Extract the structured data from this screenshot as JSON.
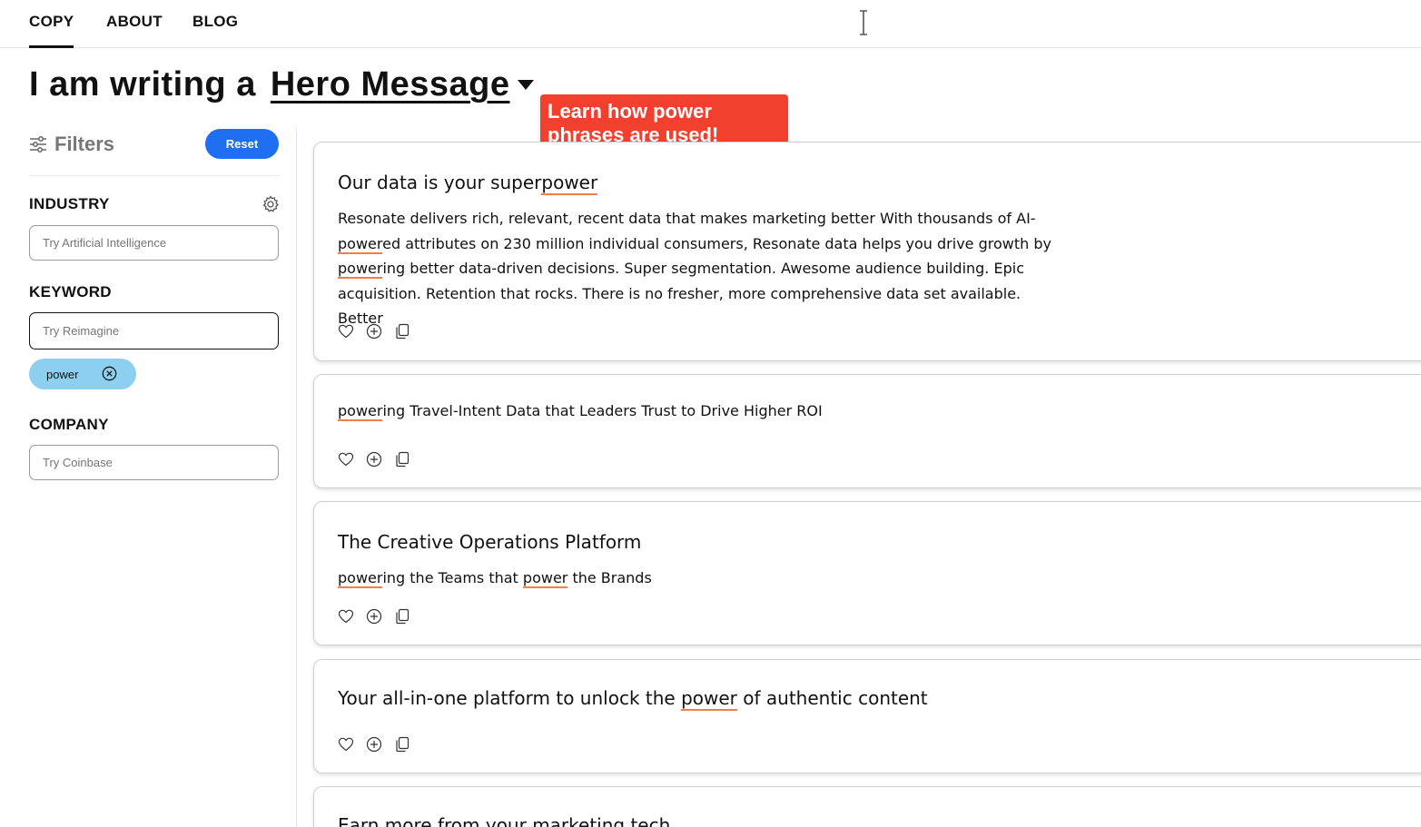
{
  "nav": {
    "items": [
      {
        "label": "COPY",
        "active": true
      },
      {
        "label": "ABOUT",
        "active": false
      },
      {
        "label": "BLOG",
        "active": false
      }
    ]
  },
  "heading": {
    "prefix": "I am writing a",
    "selected": "Hero Message"
  },
  "tooltip": {
    "text": "Learn how power phrases are used!"
  },
  "filters": {
    "title": "Filters",
    "reset_label": "Reset",
    "industry": {
      "label": "INDUSTRY",
      "placeholder": "Try Artificial Intelligence"
    },
    "keyword": {
      "label": "KEYWORD",
      "placeholder": "Try Reimagine",
      "chip": "power"
    },
    "company": {
      "label": "COMPANY",
      "placeholder": "Try Coinbase"
    }
  },
  "cards": [
    {
      "title": {
        "pre": "Our data is your super",
        "hl": "power",
        "post": ""
      },
      "body": {
        "s1": "Resonate delivers rich, relevant, recent data that makes marketing better With thousands of AI-",
        "h1": "power",
        "s2": "ed attributes on 230 million individual consumers, Resonate data helps you drive growth by",
        "h2": "power",
        "s3": "ing better data-driven decisions. Super segmentation. Awesome audience building. Epic acquisition. Retention that rocks. There is no fresher, more comprehensive data set available. Better"
      }
    },
    {
      "title": {
        "hl": "power",
        "post": "ing Travel-Intent Data that Leaders Trust to Drive Higher ROI"
      }
    },
    {
      "title": {
        "text": "The Creative Operations Platform"
      },
      "body": {
        "h1": "power",
        "s1": "ing the Teams that ",
        "h2": "power",
        "s2": " the Brands"
      }
    },
    {
      "title": {
        "pre": "Your all-in-one platform to unlock the ",
        "hl": "power",
        "post": " of authentic content"
      }
    },
    {
      "title": {
        "text": "Earn more from your marketing tech"
      }
    }
  ],
  "icons": {
    "filters": "sliders-icon",
    "gear": "gear-icon",
    "chip_remove": "close-circle-icon",
    "like": "heart-icon",
    "add": "plus-circle-icon",
    "copy": "copy-icon"
  },
  "colors": {
    "accent_blue": "#1f6ff2",
    "tooltip_red": "#f2402e",
    "chip_blue": "#8dcfee",
    "highlight_orange": "#f08049"
  }
}
